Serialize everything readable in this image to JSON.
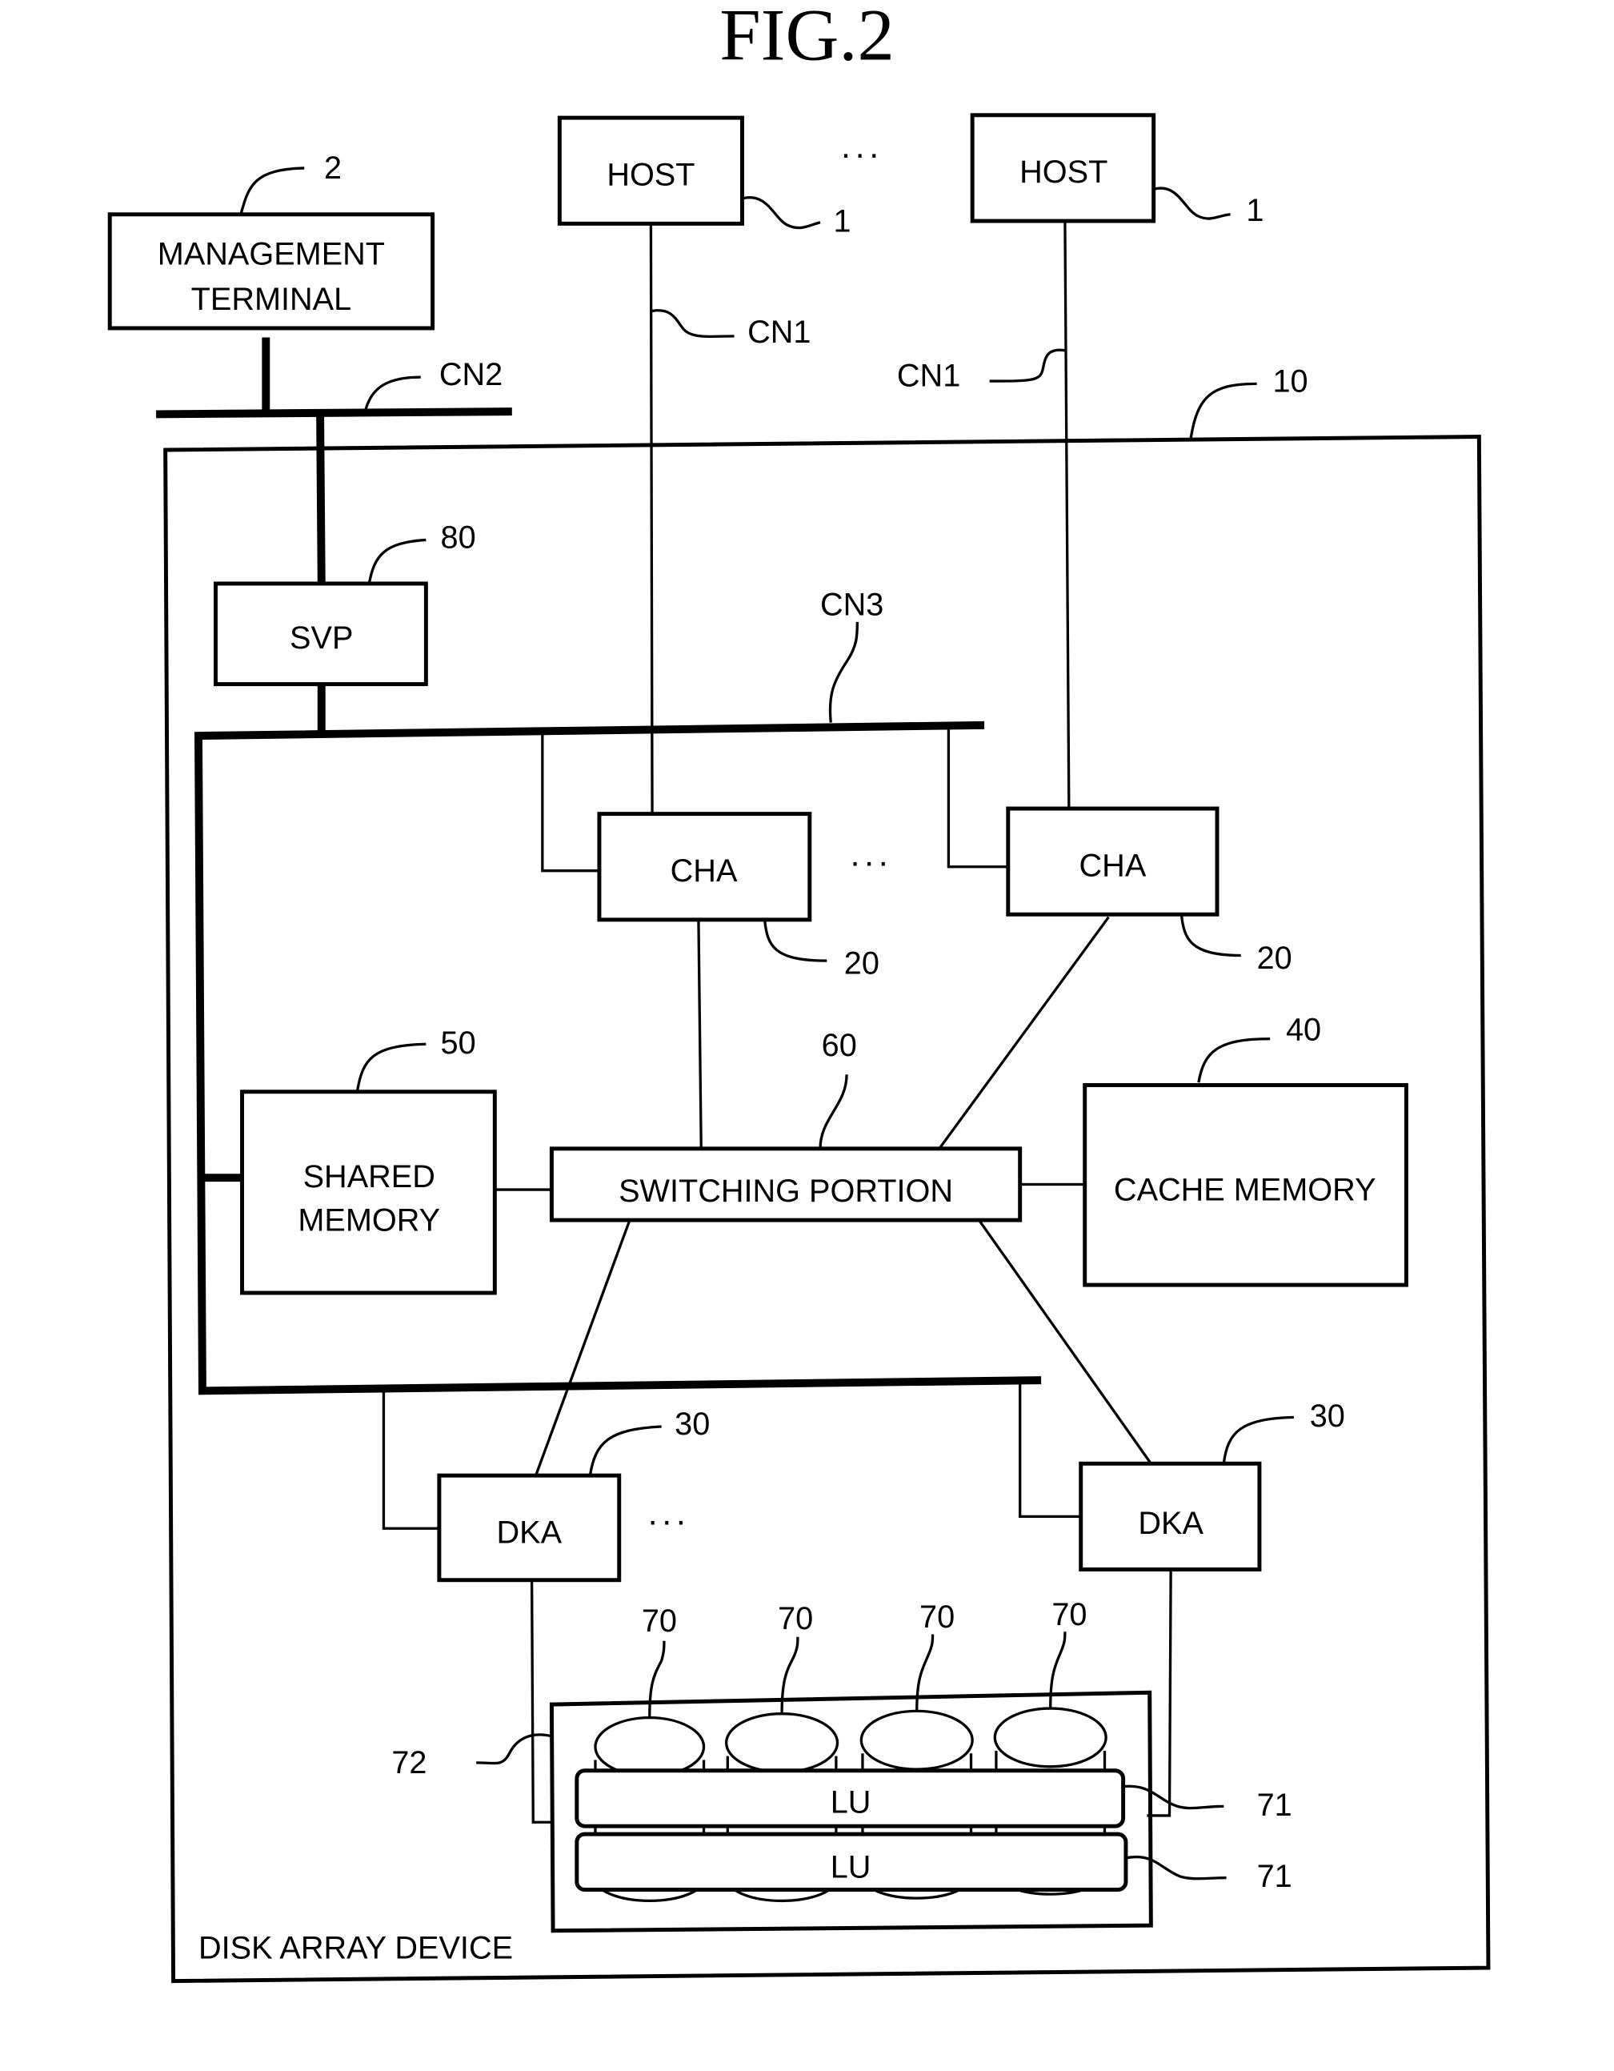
{
  "figure": {
    "title": "FIG.2",
    "ellipsis": "···",
    "nodes": {
      "management_terminal": {
        "line1": "MANAGEMENT",
        "line2": "TERMINAL",
        "ref": "2"
      },
      "host_a": {
        "label": "HOST",
        "ref": "1"
      },
      "host_b": {
        "label": "HOST",
        "ref": "1"
      },
      "disk_array": {
        "label": "DISK ARRAY DEVICE",
        "ref": "10"
      },
      "svp": {
        "label": "SVP",
        "ref": "80"
      },
      "cha_a": {
        "label": "CHA",
        "ref": "20"
      },
      "cha_b": {
        "label": "CHA",
        "ref": "20"
      },
      "shared_memory": {
        "line1": "SHARED",
        "line2": "MEMORY",
        "ref": "50"
      },
      "switching_portion": {
        "label": "SWITCHING PORTION",
        "ref": "60"
      },
      "cache_memory": {
        "label": "CACHE MEMORY",
        "ref": "40"
      },
      "dka_a": {
        "label": "DKA",
        "ref": "30"
      },
      "dka_b": {
        "label": "DKA",
        "ref": "30"
      },
      "disk_group": {
        "ref": "72"
      },
      "disks": [
        {
          "ref": "70"
        },
        {
          "ref": "70"
        },
        {
          "ref": "70"
        },
        {
          "ref": "70"
        }
      ],
      "lu_a": {
        "label": "LU",
        "ref": "71"
      },
      "lu_b": {
        "label": "LU",
        "ref": "71"
      }
    },
    "networks": {
      "cn1_a": "CN1",
      "cn1_b": "CN1",
      "cn2": "CN2",
      "cn3": "CN3"
    }
  }
}
